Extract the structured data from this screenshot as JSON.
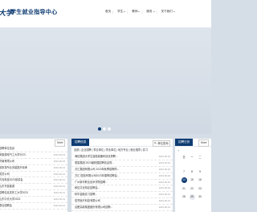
{
  "header": {
    "logo_mark": "大学",
    "logo_text": "学生就业指导中心",
    "nav": [
      {
        "label": "首页",
        "has_menu": false
      },
      {
        "label": "学生",
        "has_menu": true
      },
      {
        "label": "教师",
        "has_menu": true
      },
      {
        "label": "服务",
        "has_menu": true
      },
      {
        "label": "关于我们",
        "has_menu": true
      }
    ]
  },
  "carousel": {
    "slides": 3,
    "active": 0
  },
  "panel_left": {
    "title": "",
    "more": "More",
    "rows": [
      {
        "title": "招聘单位信息",
        "date": ""
      },
      {
        "title": "新能源电气工大学2023",
        "date": "2023-06-03"
      },
      {
        "title": "济南有限公司",
        "date": "2023-06-03"
      },
      {
        "title": "冠事务所业务能提升前辈",
        "date": "2023-06-01"
      },
      {
        "title": "成员公司",
        "date": "2023-06-01"
      },
      {
        "title": "青岛科技2023宣讲会",
        "date": "2023-06-01"
      },
      {
        "title": "山东东营能源",
        "date": "2023-05-31"
      },
      {
        "title": "招聘信息发布工大学2023",
        "date": "2023-05-31"
      },
      {
        "title": "山东中天大学2023",
        "date": "2023-05-31"
      },
      {
        "title": "联合招聘会",
        "date": "2023-05-31"
      }
    ]
  },
  "panel_mid": {
    "title": "招聘信息",
    "search_label": "单位查询",
    "tabs": "全部 | 企业招聘 | 事业单位 | 事业单位 | 地方专业 | 就业指导 | 实习",
    "rows": [
      {
        "title": "海信集团大学生智能装备科技优质聘...",
        "date": "2023-06-02"
      },
      {
        "title": "惠智集团 2023届校园招聘信息简...",
        "date": "2023-06-02"
      },
      {
        "title": "万汇集团有限公司 2023年秋季招聘简...",
        "date": "2023-06-02"
      },
      {
        "title": "万汇·国信有限公司2023年春季招聘会...",
        "date": "2023-06-02"
      },
      {
        "title": "广州新华职业技术学院招聘...",
        "date": "2023-06-02"
      },
      {
        "title": "和信文化特区招聘会...",
        "date": "2023-06-02"
      },
      {
        "title": "科华金融实习招聘...",
        "date": "2023-06-01"
      },
      {
        "title": "宏誉医疗科技有限公司",
        "date": "2023-06-01"
      },
      {
        "title": "合肥高新集团股份有限公司招聘...",
        "date": "2023-06-01"
      },
      {
        "title": "东方汇理科技有限公司...",
        "date": "2023-06-01"
      }
    ]
  },
  "panel_right": {
    "title": "招聘日历",
    "more": "More",
    "month": "",
    "weekdays": [
      "日",
      "一",
      "二"
    ],
    "days": [
      "",
      "",
      "",
      "7",
      "8",
      "9",
      "14",
      "15",
      "16",
      "21",
      "22",
      "23",
      "28",
      "29",
      "30"
    ],
    "selected_day": "14",
    "highlight_day": "29"
  },
  "colors": {
    "primary": "#0e3b72",
    "page_bg": "#d5dde6"
  }
}
